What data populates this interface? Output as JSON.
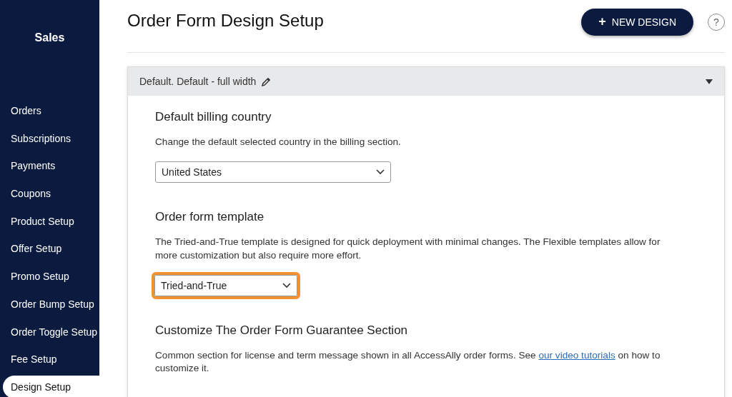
{
  "sidebar": {
    "title": "Sales",
    "items": [
      {
        "label": "Orders",
        "selected": false
      },
      {
        "label": "Subscriptions",
        "selected": false
      },
      {
        "label": "Payments",
        "selected": false
      },
      {
        "label": "Coupons",
        "selected": false
      },
      {
        "label": "Product Setup",
        "selected": false
      },
      {
        "label": "Offer Setup",
        "selected": false
      },
      {
        "label": "Promo Setup",
        "selected": false
      },
      {
        "label": "Order Bump Setup",
        "selected": false
      },
      {
        "label": "Order Toggle Setup",
        "selected": false
      },
      {
        "label": "Fee Setup",
        "selected": false
      },
      {
        "label": "Design Setup",
        "selected": true
      }
    ]
  },
  "page": {
    "title": "Order Form Design Setup",
    "new_button": {
      "icon": "+",
      "label": "NEW DESIGN"
    },
    "help": "?"
  },
  "panel": {
    "title": "Default. Default - full width",
    "expanded": true,
    "sections": [
      {
        "heading": "Default billing country",
        "text": "Change the default selected country in the billing section.",
        "select": {
          "value": "United States",
          "highlighted": false
        }
      },
      {
        "heading": "Order form template",
        "text": "The Tried-and-True template is designed for quick deployment with minimal changes. The Flexible templates allow for more customization but also require more effort.",
        "select": {
          "value": "Tried-and-True",
          "highlighted": true
        }
      },
      {
        "heading": "Customize The Order Form Guarantee Section",
        "text": "Common section for license and term message shown in all AccessAlly order forms. See ",
        "link": "our video tutorials",
        "text_after": " on how to customize it."
      }
    ]
  }
}
